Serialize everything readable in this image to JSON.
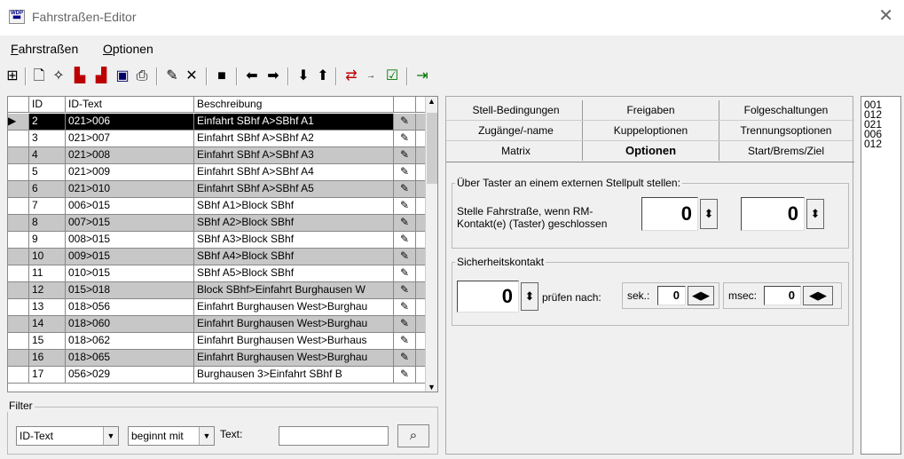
{
  "window": {
    "title": "Fahrstraßen-Editor",
    "app_icon": "WDP",
    "close": "✕"
  },
  "menu": {
    "items": [
      {
        "label": "Fahrstraßen",
        "accel": "F"
      },
      {
        "label": "Optionen",
        "accel": "O"
      }
    ]
  },
  "toolbar": {
    "icons": [
      "tree-view-icon",
      "new-page-icon",
      "new-wizard-icon",
      "train-right-icon",
      "train-left-icon",
      "save-icon",
      "print-icon",
      "erase-icon",
      "delete-icon",
      "block-icon",
      "arrow-left-icon",
      "arrow-right-icon",
      "arrow-down-icon",
      "arrow-up-icon",
      "sort-icon",
      "speed-icon",
      "checkbox-icon",
      "exit-icon"
    ]
  },
  "table": {
    "headers": [
      "ID",
      "ID-Text",
      "Beschreibung"
    ],
    "rows": [
      {
        "id": "2",
        "text": "021>006",
        "desc": "Einfahrt SBhf A>SBhf A1",
        "selected": true
      },
      {
        "id": "3",
        "text": "021>007",
        "desc": "Einfahrt SBhf A>SBhf A2"
      },
      {
        "id": "4",
        "text": "021>008",
        "desc": "Einfahrt SBhf A>SBhf A3"
      },
      {
        "id": "5",
        "text": "021>009",
        "desc": "Einfahrt SBhf A>SBhf A4"
      },
      {
        "id": "6",
        "text": "021>010",
        "desc": "Einfahrt SBhf A>SBhf A5"
      },
      {
        "id": "7",
        "text": "006>015",
        "desc": "SBhf A1>Block SBhf"
      },
      {
        "id": "8",
        "text": "007>015",
        "desc": "SBhf A2>Block SBhf"
      },
      {
        "id": "9",
        "text": "008>015",
        "desc": "SBhf A3>Block SBhf"
      },
      {
        "id": "10",
        "text": "009>015",
        "desc": "SBhf A4>Block SBhf"
      },
      {
        "id": "11",
        "text": "010>015",
        "desc": "SBhf A5>Block SBhf"
      },
      {
        "id": "12",
        "text": "015>018",
        "desc": "Block SBhf>Einfahrt Burghausen W"
      },
      {
        "id": "13",
        "text": "018>056",
        "desc": "Einfahrt Burghausen West>Burghau"
      },
      {
        "id": "14",
        "text": "018>060",
        "desc": "Einfahrt Burghausen West>Burghau"
      },
      {
        "id": "15",
        "text": "018>062",
        "desc": "Einfahrt Burghausen West>Burhaus"
      },
      {
        "id": "16",
        "text": "018>065",
        "desc": "Einfahrt Burghausen West>Burghau"
      },
      {
        "id": "17",
        "text": "056>029",
        "desc": "Burghausen 3>Einfahrt SBhf B"
      }
    ]
  },
  "filter": {
    "label": "Filter",
    "field": "ID-Text",
    "mode": "beginnt mit",
    "text_label": "Text:",
    "text_value": ""
  },
  "tabs": {
    "row1": [
      "Stell-Bedingungen",
      "Freigaben",
      "Folgeschaltungen"
    ],
    "row2": [
      "Zugänge/-name",
      "Kuppeloptionen",
      "Trennungsoptionen"
    ],
    "row3": [
      "Matrix",
      "Optionen",
      "Start/Brems/Ziel"
    ],
    "active": "Optionen"
  },
  "options": {
    "taster_group": "Über Taster an einem externen Stellpult stellen:",
    "taster_text": "Stelle Fahrstraße, wenn RM-Kontakt(e) (Taster) geschlossen",
    "taster_value1": "0",
    "taster_value2": "0",
    "sicherheit_group": "Sicherheitskontakt",
    "sicherheit_value": "0",
    "pruefen_label": "prüfen nach:",
    "sek_label": "sek.:",
    "sek_value": "0",
    "msec_label": "msec:",
    "msec_value": "0"
  },
  "list": {
    "items": [
      "001",
      "012",
      "021",
      "006",
      "012"
    ]
  }
}
